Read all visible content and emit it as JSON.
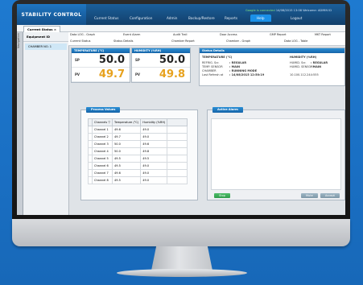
{
  "app": {
    "brand": "STABILITY CONTROL",
    "nav": [
      "Current Status",
      "Configuration",
      "Admin",
      "Backup/Restore",
      "Reports",
      "Help",
      "Logout"
    ],
    "active_nav": "Help",
    "status_google": "Google is connected",
    "status_datetime": "14/08/2015 13:08",
    "status_welcome": "Welcome: ADMIN ID"
  },
  "tabs": {
    "current": "Current Status",
    "side_nav": "Navigation"
  },
  "equipment": {
    "header": "Equipment ID",
    "selected": "CHAMBER NO. 1"
  },
  "columns": {
    "row1": [
      "Data LOG - Graph",
      "Event Alarm",
      "Audit Trail",
      "Door Access",
      "GMP Report",
      "MKT Report"
    ],
    "row2": [
      "Current Status",
      "Status Details",
      "Chamber Report",
      "Chamber - Graph",
      "Data LOG - Table"
    ]
  },
  "temperature": {
    "title": "TEMPERATURE (°C)",
    "sp_label": "SP",
    "sp": "50.0",
    "pv_label": "PV",
    "pv": "49.7"
  },
  "humidity": {
    "title": "HUMIDITY (%RH)",
    "sp_label": "SP",
    "sp": "50.0",
    "pv_label": "PV",
    "pv": "49.8"
  },
  "status_details": {
    "title": "Status Details",
    "left_head": "TEMPERATURE (°C)",
    "right_head": "HUMIDITY (%RH)",
    "left_rows": [
      {
        "k": "REFRIG. Scr.",
        "v": ": REGULAR"
      },
      {
        "k": "TEMP. SENSOR",
        "v": ": MAIN"
      },
      {
        "k": "CHAMBER",
        "v": ": RUNNING MODE"
      },
      {
        "k": "Last Refresh at",
        "v": ": 14/08/2015 12:50:19"
      }
    ],
    "right_rows": [
      {
        "k": "HUMID. Scr.",
        "v": ": REGULAR"
      },
      {
        "k": "HUMID. SENSOR",
        "v": ": MAIN"
      },
      {
        "k": "",
        "v": ""
      },
      {
        "k": "",
        "v": "10.100.112.244:555"
      }
    ]
  },
  "process_values": {
    "title": "Process Values",
    "headers": [
      "Channels",
      "Temperature (°C)",
      "Humidity (%RH)"
    ],
    "rows": [
      [
        "Channel 1",
        "49.6",
        "49.0"
      ],
      [
        "Channel 2",
        "49.7",
        "49.0"
      ],
      [
        "Channel 3",
        "50.0",
        "49.6"
      ],
      [
        "Channel 4",
        "50.0",
        "49.8"
      ],
      [
        "Channel 5",
        "49.5",
        "49.5"
      ],
      [
        "Channel 6",
        "49.5",
        "49.0"
      ],
      [
        "Channel 7",
        "49.6",
        "49.0"
      ],
      [
        "Channel 8",
        "49.5",
        "49.0"
      ]
    ]
  },
  "active_alarm": {
    "title": "Active Alarm",
    "buttons": [
      "Stop",
      "Mute",
      "Accept"
    ]
  }
}
